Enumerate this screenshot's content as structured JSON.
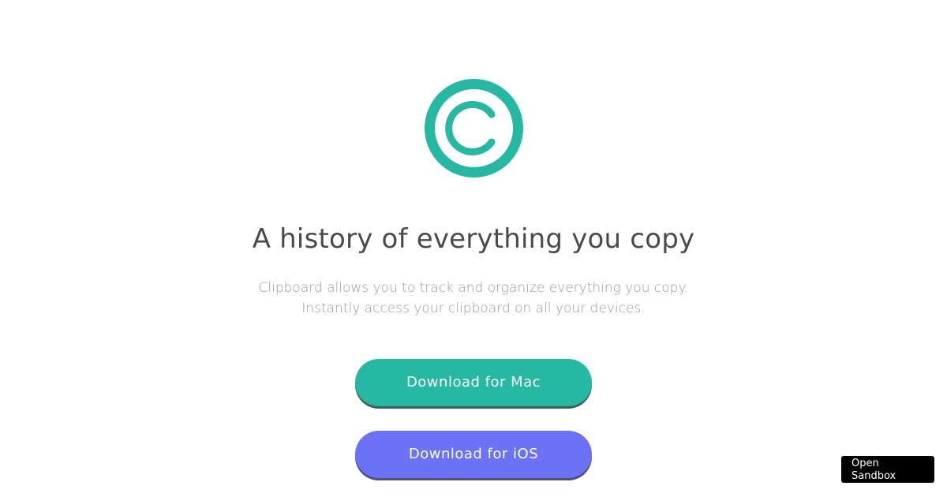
{
  "logo": {
    "icon": "copyright-c-icon",
    "color": "#26b8a3"
  },
  "hero": {
    "headline": "A history of everything you copy",
    "subtitle_line1": "Clipboard allows you to track and organize everything you copy.",
    "subtitle_line2": "Instantly access your clipboard on all your devices."
  },
  "buttons": {
    "mac_label": "Download for Mac",
    "mac_color": "#26b8a3",
    "ios_label": "Download for iOS",
    "ios_color": "#6b72f5"
  },
  "sandbox": {
    "line1": "Open",
    "line2": "Sandbox"
  }
}
